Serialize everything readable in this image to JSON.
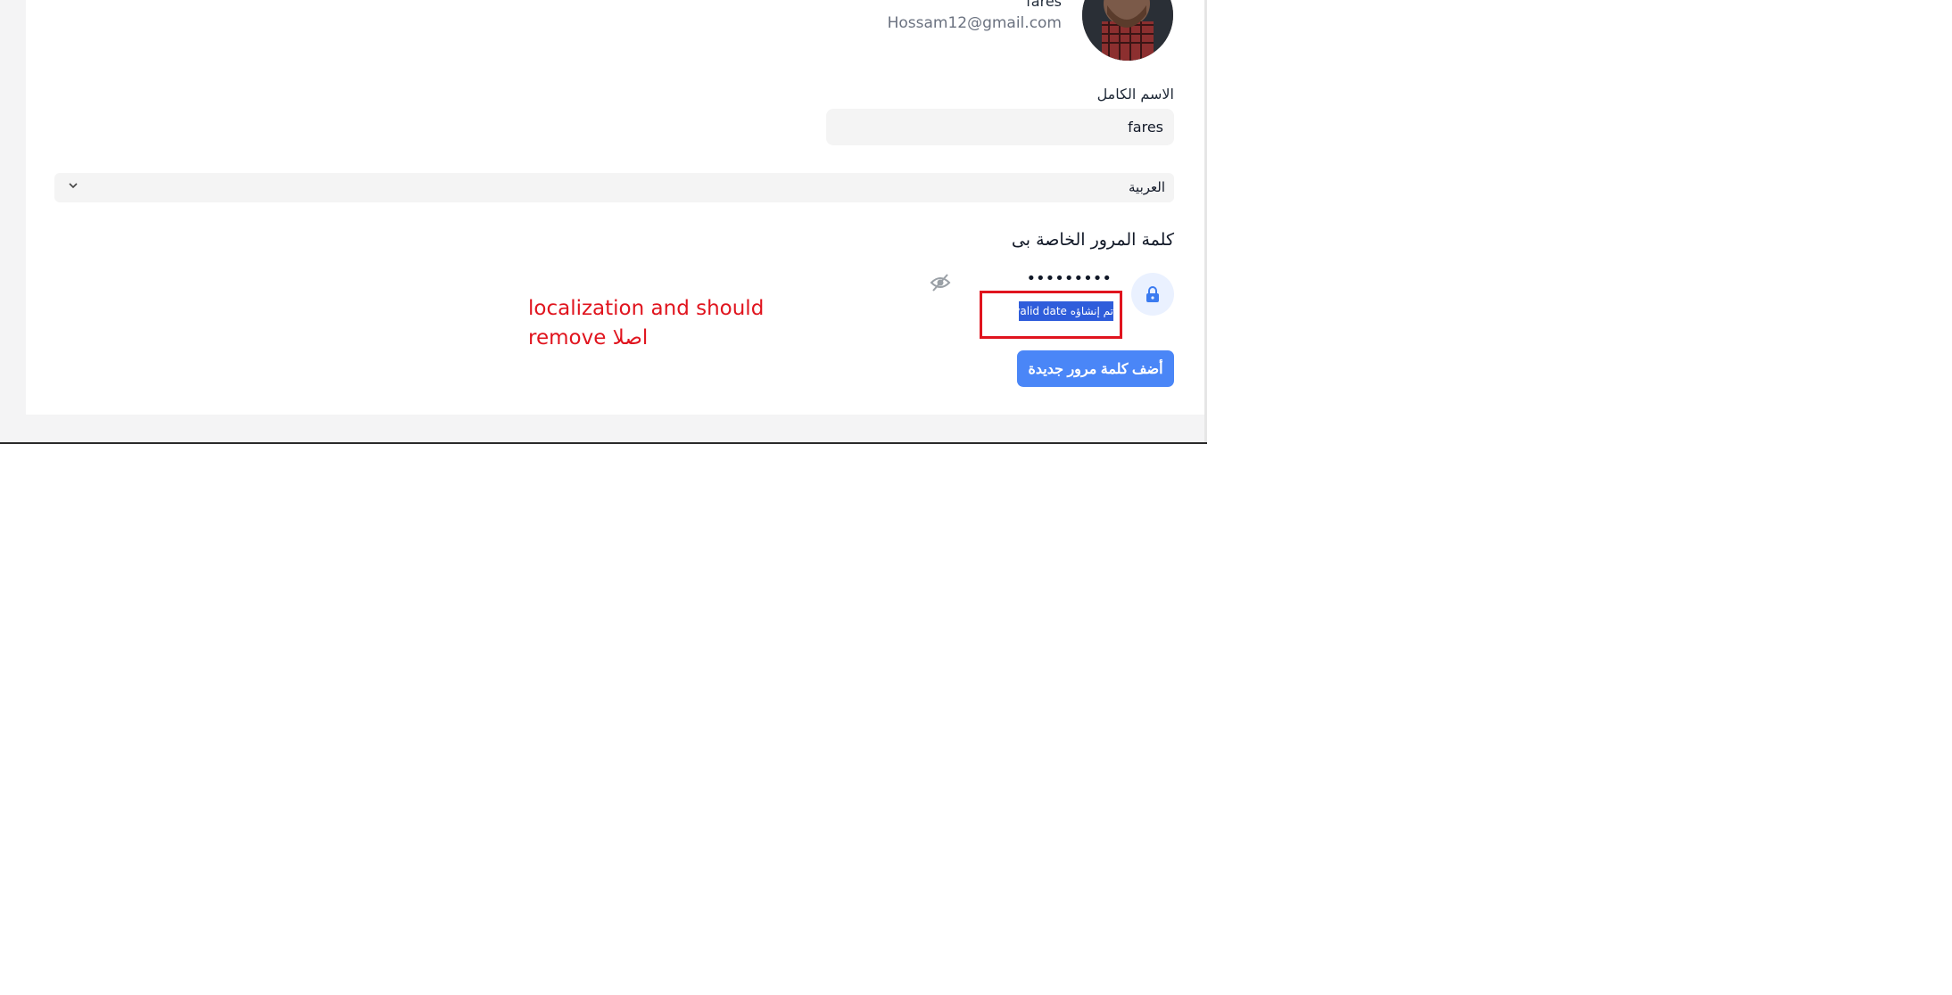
{
  "profile": {
    "name": "fares",
    "email": "Hossam12@gmail.com"
  },
  "form": {
    "full_name_label": "الاسم الكامل",
    "full_name_value": "fares",
    "language_value": "العربية"
  },
  "password_section": {
    "title": "كلمة المرور الخاصة بى",
    "masked_password": "•••••••••",
    "created_text": "تم إنشاؤه Invalid date",
    "add_button_label": "أضف كلمة مرور جديدة"
  },
  "annotation": {
    "line1": "localization and should",
    "line2": "remove  اصلا"
  },
  "colors": {
    "primary_button": "#4a86f7",
    "annotation_red": "#e0141e",
    "selection_blue": "#2f5ddb"
  },
  "icons": [
    "avatar",
    "lock-icon",
    "eye-off-icon",
    "chevron-down-icon"
  ]
}
